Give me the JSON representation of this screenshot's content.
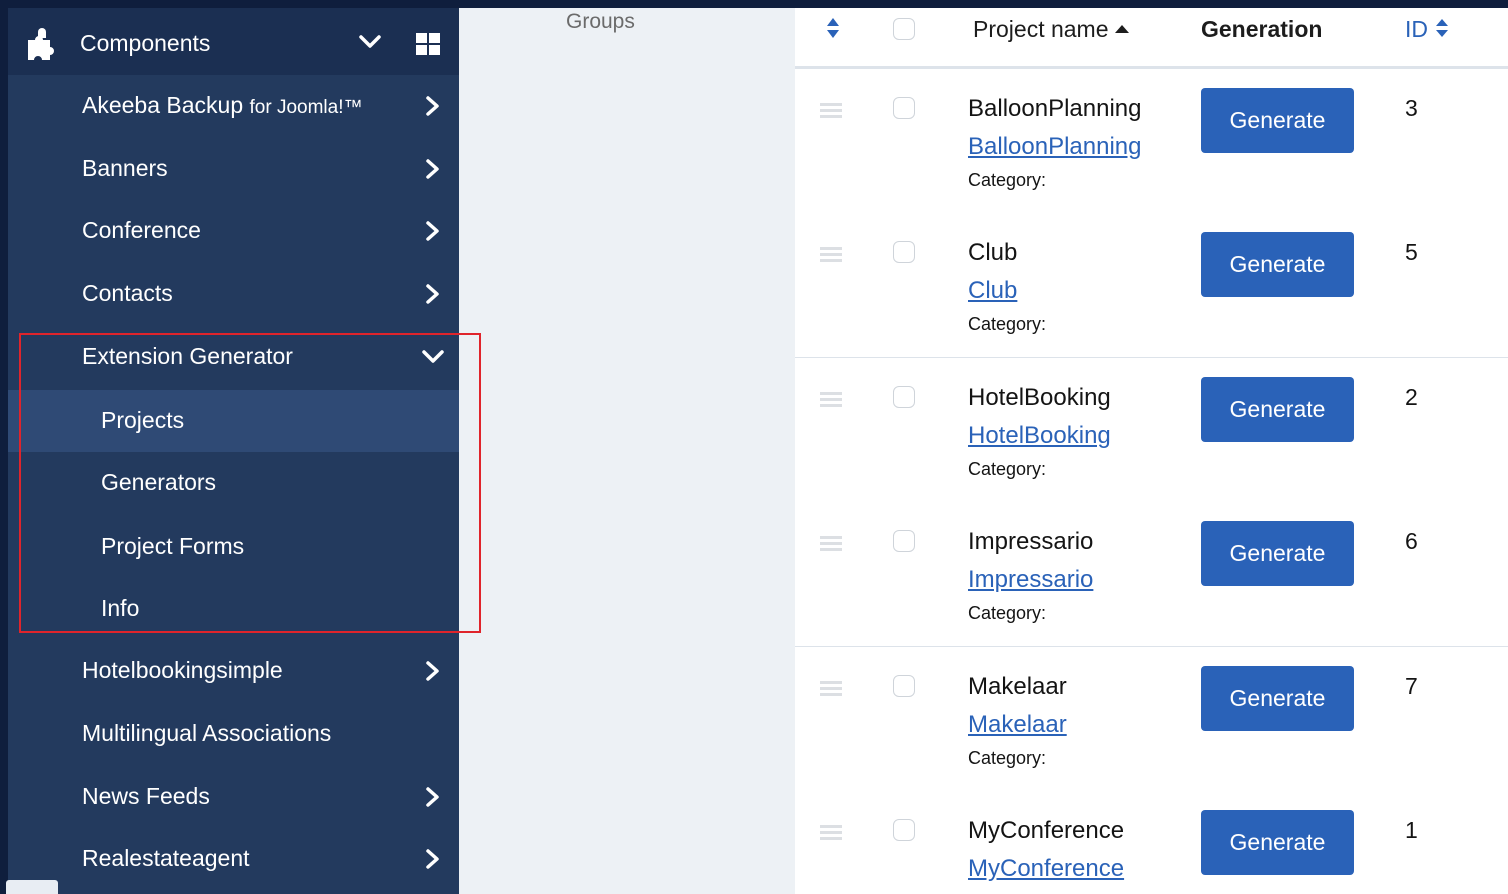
{
  "sidebar": {
    "header": {
      "title": "Components"
    },
    "items": [
      {
        "label": "Akeeba Backup",
        "suffix": "for Joomla!™"
      },
      {
        "label": "Banners"
      },
      {
        "label": "Conference"
      },
      {
        "label": "Contacts"
      },
      {
        "label": "Extension Generator"
      },
      {
        "label": "Hotelbookingsimple"
      },
      {
        "label": "Multilingual Associations"
      },
      {
        "label": "News Feeds"
      },
      {
        "label": "Realestateagent"
      }
    ],
    "subitems": [
      {
        "label": "Projects"
      },
      {
        "label": "Generators"
      },
      {
        "label": "Project Forms"
      },
      {
        "label": "Info"
      }
    ]
  },
  "middle": {
    "groups_label": "Groups"
  },
  "table": {
    "columns": {
      "name": "Project name",
      "generation": "Generation",
      "id": "ID"
    },
    "category_label": "Category:",
    "button_label": "Generate",
    "rows": [
      {
        "name": "BalloonPlanning",
        "link": "BalloonPlanning",
        "id": "3"
      },
      {
        "name": "Club",
        "link": "Club",
        "id": "5"
      },
      {
        "name": "HotelBooking",
        "link": "HotelBooking",
        "id": "2"
      },
      {
        "name": "Impressario",
        "link": "Impressario",
        "id": "6"
      },
      {
        "name": "Makelaar",
        "link": "Makelaar",
        "id": "7"
      },
      {
        "name": "MyConference",
        "link": "MyConference",
        "id": "1"
      }
    ]
  },
  "colors": {
    "sidebar_bg": "#233a5e",
    "header_bg": "#1b2f52",
    "active_bg": "#2f4a75",
    "accent": "#2a62b8",
    "highlight": "#e0242b"
  }
}
